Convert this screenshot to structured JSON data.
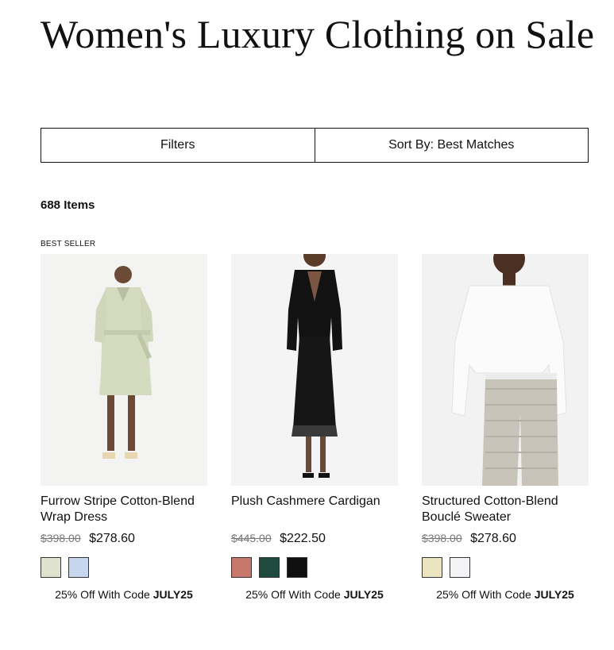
{
  "page": {
    "title": "Women's Luxury Clothing on Sale"
  },
  "toolbar": {
    "filters_label": "Filters",
    "sort_label": "Sort By: Best Matches"
  },
  "results": {
    "count": "688 Items"
  },
  "products": [
    {
      "badge": "BEST SELLER",
      "name": "Furrow Stripe Cotton-Blend Wrap Dress",
      "original_price": "$398.00",
      "sale_price": "$278.60",
      "swatch_colors": [
        "#dfe2cf",
        "#c6d6ec"
      ],
      "promo_text": "25% Off With Code",
      "promo_code": "JULY25"
    },
    {
      "badge": "",
      "name": "Plush Cashmere Cardigan",
      "original_price": "$445.00",
      "sale_price": "$222.50",
      "swatch_colors": [
        "#c9776d",
        "#1f4a3e",
        "#0f0f0f"
      ],
      "promo_text": "25% Off With Code",
      "promo_code": "JULY25"
    },
    {
      "badge": "",
      "name": "Structured Cotton-Blend Bouclé Sweater",
      "original_price": "$398.00",
      "sale_price": "$278.60",
      "swatch_colors": [
        "#ece3bf",
        "#f4f4f6"
      ],
      "promo_text": "25% Off With Code",
      "promo_code": "JULY25"
    }
  ]
}
